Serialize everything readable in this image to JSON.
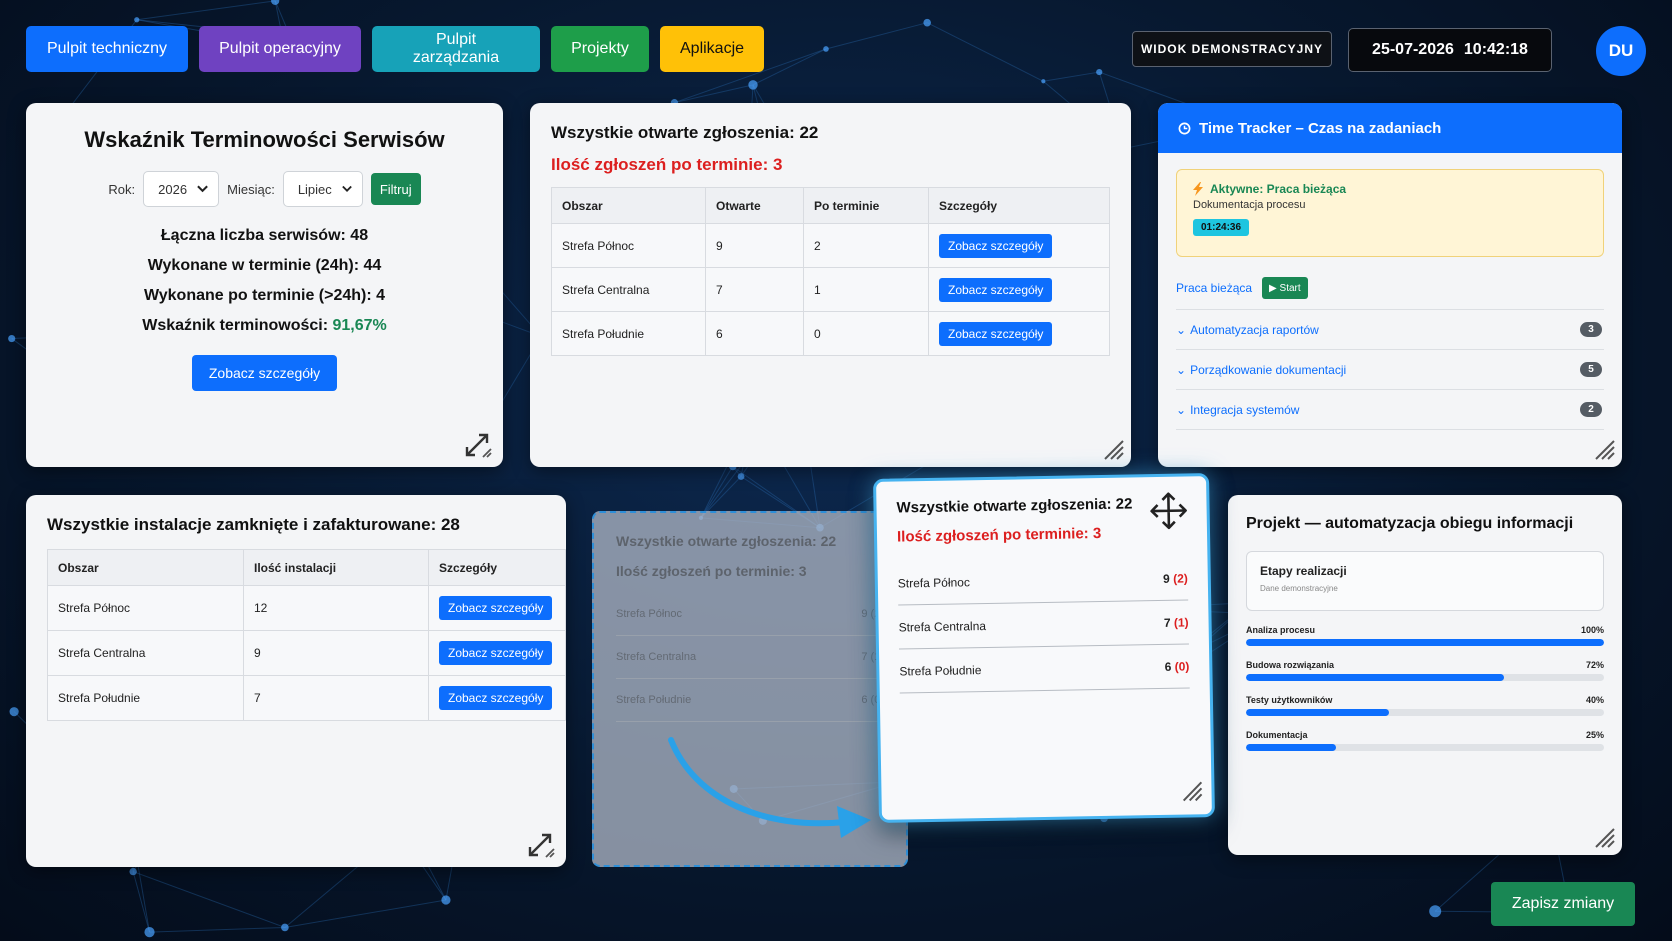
{
  "nav": [
    {
      "label": "Pulpit techniczny",
      "color": "#0d6efd"
    },
    {
      "label": "Pulpit operacyjny",
      "color": "#6f42c1"
    },
    {
      "label": "Pulpit zarządzania",
      "color": "#17a2b8"
    },
    {
      "label": "Projekty",
      "color": "#1e9e4a"
    },
    {
      "label": "Aplikacje",
      "color": "#ffc107"
    }
  ],
  "header": {
    "demo_badge": "WIDOK DEMONSTRACYJNY",
    "date": "25-07-2026",
    "time": "10:42:18",
    "avatar_initials": "DU"
  },
  "timeliness": {
    "title": "Wskaźnik Terminowości Serwisów",
    "year_label": "Rok:",
    "year_value": "2026",
    "month_label": "Miesiąc:",
    "month_value": "Lipiec",
    "filter_button": "Filtruj",
    "total_label": "Łączna liczba serwisów: ",
    "total_value": "48",
    "on_time_label": "Wykonane w terminie (24h): ",
    "on_time_value": "44",
    "late_label": "Wykonane po terminie (>24h): ",
    "late_value": "4",
    "rate_label": "Wskaźnik terminowości: ",
    "rate_value": "91,67%",
    "details_button": "Zobacz szczegóły"
  },
  "open_tickets": {
    "title": "Wszystkie otwarte zgłoszenia: 22",
    "late_title": "Ilość zgłoszeń po terminie: 3",
    "columns": [
      "Obszar",
      "Otwarte",
      "Po terminie",
      "Szczegóły"
    ],
    "rows": [
      {
        "area": "Strefa Północ",
        "open": "9",
        "late": "2",
        "action": "Zobacz szczegóły"
      },
      {
        "area": "Strefa Centralna",
        "open": "7",
        "late": "1",
        "action": "Zobacz szczegóły"
      },
      {
        "area": "Strefa Południe",
        "open": "6",
        "late": "0",
        "action": "Zobacz szczegóły"
      }
    ]
  },
  "time_tracker": {
    "title": "Time Tracker – Czas na zadaniach",
    "active_title": "Aktywne: Praca bieżąca",
    "active_sub": "Dokumentacja procesu",
    "timer": "01:24:36",
    "current_label": "Praca bieżąca",
    "start_button": "Start",
    "tasks": [
      {
        "label": "Automatyzacja raportów",
        "count": "3"
      },
      {
        "label": "Porządkowanie dokumentacji",
        "count": "5"
      },
      {
        "label": "Integracja systemów",
        "count": "2"
      }
    ]
  },
  "installations": {
    "title": "Wszystkie instalacje zamknięte i zafakturowane: 28",
    "columns": [
      "Obszar",
      "Ilość instalacji",
      "Szczegóły"
    ],
    "rows": [
      {
        "area": "Strefa Północ",
        "count": "12",
        "action": "Zobacz szczegóły"
      },
      {
        "area": "Strefa Centralna",
        "count": "9",
        "action": "Zobacz szczegóły"
      },
      {
        "area": "Strefa Południe",
        "count": "7",
        "action": "Zobacz szczegóły"
      }
    ]
  },
  "ghost": {
    "title": "Wszystkie otwarte zgłoszenia: 22",
    "sub": "Ilość zgłoszeń po terminie: 3",
    "rows": [
      {
        "area": "Strefa Północ",
        "value": "9 (2)"
      },
      {
        "area": "Strefa Centralna",
        "value": "7 (1)"
      },
      {
        "area": "Strefa Południe",
        "value": "6 (0)"
      }
    ]
  },
  "dragged": {
    "title": "Wszystkie otwarte zgłoszenia: 22",
    "sub": "Ilość zgłoszeń po terminie: 3",
    "rows": [
      {
        "area": "Strefa Północ",
        "open": "9",
        "late": "(2)"
      },
      {
        "area": "Strefa Centralna",
        "open": "7",
        "late": "(1)"
      },
      {
        "area": "Strefa Południe",
        "open": "6",
        "late": "(0)"
      }
    ]
  },
  "project": {
    "title": "Projekt — automatyzacja obiegu informacji",
    "stages_title": "Etapy realizacji",
    "stages_sub": "Dane demonstracyjne",
    "stages": [
      {
        "label": "Analiza procesu",
        "percent": 100
      },
      {
        "label": "Budowa rozwiązania",
        "percent": 72
      },
      {
        "label": "Testy użytkowników",
        "percent": 40
      },
      {
        "label": "Dokumentacja",
        "percent": 25
      }
    ]
  },
  "save_button": "Zapisz zmiany"
}
